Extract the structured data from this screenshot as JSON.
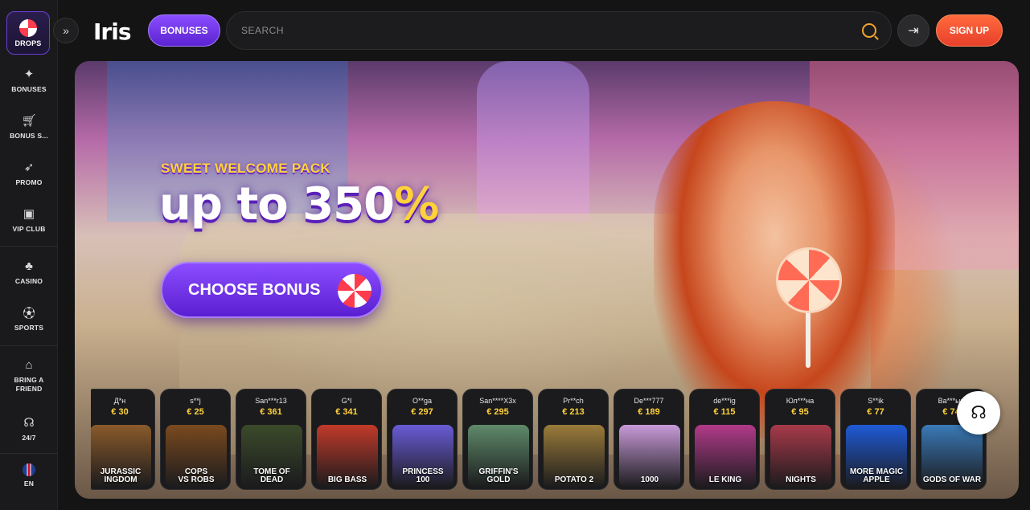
{
  "sidebar": {
    "drops_label": "DROPS",
    "items": [
      {
        "label": "BONUSES",
        "icon": "gift-icon"
      },
      {
        "label": "BONUS S...",
        "icon": "cart-icon"
      },
      {
        "label": "PROMO",
        "icon": "rocket-icon"
      },
      {
        "label": "VIP CLUB",
        "icon": "vip-icon"
      },
      {
        "label": "CASINO",
        "icon": "cherries-icon"
      },
      {
        "label": "SPORTS",
        "icon": "ball-icon"
      },
      {
        "label": "BRING A FRIEND",
        "icon": "basket-icon"
      },
      {
        "label": "24/7",
        "icon": "headset-icon"
      },
      {
        "label": "EN",
        "icon": "uk-flag-icon"
      }
    ]
  },
  "header": {
    "logo_text": "Iris",
    "bonuses_label": "BONUSES",
    "search_placeholder": "SEARCH",
    "signup_label": "SIGN UP"
  },
  "hero": {
    "tagline": "SWEET WELCOME PACK",
    "headline": "up to 350",
    "headline_suffix": "%",
    "cta_label": "CHOOSE BONUS"
  },
  "winners": [
    {
      "name": "Д*н",
      "amount": "€ 30",
      "game": "JURASSIC\nINGDOM",
      "color": "#8a5a2b"
    },
    {
      "name": "s**j",
      "amount": "€ 25",
      "game": "COPS\nVS ROBS",
      "color": "#7a4a1f"
    },
    {
      "name": "San***r13",
      "amount": "€ 361",
      "game": "TOME OF\nDEAD",
      "color": "#3b4a2a"
    },
    {
      "name": "G*l",
      "amount": "€ 341",
      "game": "BIG BASS",
      "color": "#c23a2a"
    },
    {
      "name": "O**ga",
      "amount": "€ 297",
      "game": "PRINCESS\n100",
      "color": "#6a5bd6"
    },
    {
      "name": "San****X3x",
      "amount": "€ 295",
      "game": "GRIFFIN'S\nGOLD",
      "color": "#5f8a6a"
    },
    {
      "name": "Pr**ch",
      "amount": "€ 213",
      "game": "POTATO 2",
      "color": "#9a7b3a"
    },
    {
      "name": "De***777",
      "amount": "€ 189",
      "game": "1000",
      "color": "#c89ad8"
    },
    {
      "name": "de***ig",
      "amount": "€ 115",
      "game": "LE KING",
      "color": "#b23a8a"
    },
    {
      "name": "Юл***на",
      "amount": "€ 95",
      "game": "NIGHTS",
      "color": "#a83a4a"
    },
    {
      "name": "S**ik",
      "amount": "€ 77",
      "game": "MORE MAGIC\nAPPLE",
      "color": "#1f5ad6"
    },
    {
      "name": "Ва***ыч",
      "amount": "€ 74",
      "game": "GODS OF WAR",
      "color": "#3a7ab8"
    }
  ]
}
